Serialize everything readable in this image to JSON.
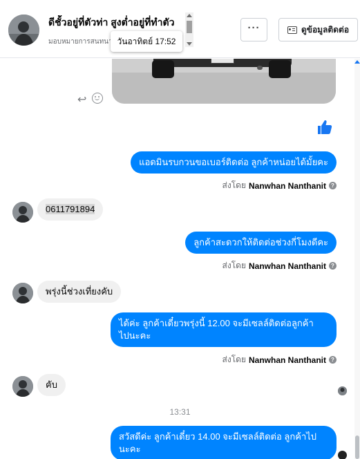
{
  "header": {
    "name": "ดีชั้วอยู่ที่ตัวท่า สูงต่ำอยู่ที่ทำตัว",
    "subtitle": "มอบหมายการสนทนา",
    "tooltip": "วันอาทิตย์ 17:52",
    "more_label": "···",
    "contact_label": "ดูข้อมูลติดต่อ"
  },
  "messages": [
    {
      "side": "out",
      "text": "แอดมินรบกวนขอเบอร์ติดต่อ ลูกค้าหน่อยได้มั้ยคะ"
    },
    {
      "side": "in",
      "text": "0611791894"
    },
    {
      "side": "out",
      "text": "ลูกค้าสะดวกให้ติดต่อช่วงกี่โมงดีคะ"
    },
    {
      "side": "in",
      "text": "พรุ่งนี้ช่วงเที่ยงคับ"
    },
    {
      "side": "out",
      "line1": "ได้ค่ะ ลูกค้าเดี๋ยวพรุ่งนี้ 12.00 จะมีเซลล์ติดต่อลูกค้า",
      "line2": "ไปนะคะ"
    },
    {
      "side": "in",
      "text": "คับ"
    },
    {
      "side": "out",
      "line1": "สวัสดีค่ะ ลูกค้าเดี๋ยว 14.00 จะมีเซลล์ติดต่อ ลูกค้าไป",
      "line2": "นะคะ"
    }
  ],
  "sent_by": {
    "prefix": "ส่งโดย",
    "name": "Nanwhan Nanthanit",
    "help": "?"
  },
  "time_separator": "13:31",
  "colors": {
    "outgoing": "#0084ff",
    "incoming": "#f0f0f0",
    "like": "#1877f2"
  },
  "icons": [
    "reply-icon",
    "emoji-icon",
    "thumbs-up-icon",
    "contact-card-icon",
    "help-icon"
  ]
}
